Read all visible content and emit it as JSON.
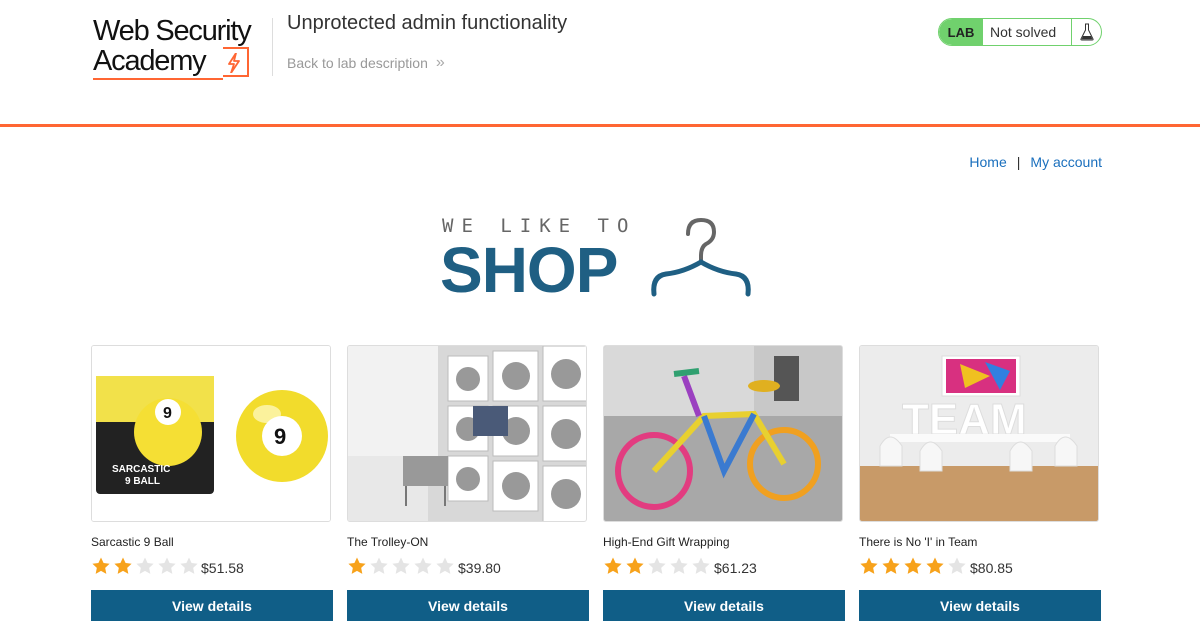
{
  "header": {
    "logo_line1": "Web Security",
    "logo_line2": "Academy",
    "lab_title": "Unprotected admin functionality",
    "back_link": "Back to lab description",
    "back_chevrons": "»",
    "status_badge": "LAB",
    "status_text": "Not solved"
  },
  "nav": {
    "home": "Home",
    "separator": "|",
    "account": "My account"
  },
  "hero": {
    "small": "WE LIKE TO",
    "big": "SHOP"
  },
  "colors": {
    "accent": "#ff6633",
    "button": "#105e87",
    "lab_green": "#70d16d",
    "link": "#1a6fbd",
    "star": "#f7a21b"
  },
  "products": [
    {
      "name": "Sarcastic 9 Ball",
      "rating": 2,
      "price": "$51.58",
      "button": "View details",
      "image_icon": "sarcastic-9-ball-image"
    },
    {
      "name": "The Trolley-ON",
      "rating": 1,
      "price": "$39.80",
      "button": "View details",
      "image_icon": "laundromat-trolley-image"
    },
    {
      "name": "High-End Gift Wrapping",
      "rating": 2,
      "price": "$61.23",
      "button": "View details",
      "image_icon": "knitted-bicycle-image"
    },
    {
      "name": "There is No 'I' in Team",
      "rating": 4,
      "price": "$80.85",
      "button": "View details",
      "image_icon": "team-sign-image"
    }
  ]
}
